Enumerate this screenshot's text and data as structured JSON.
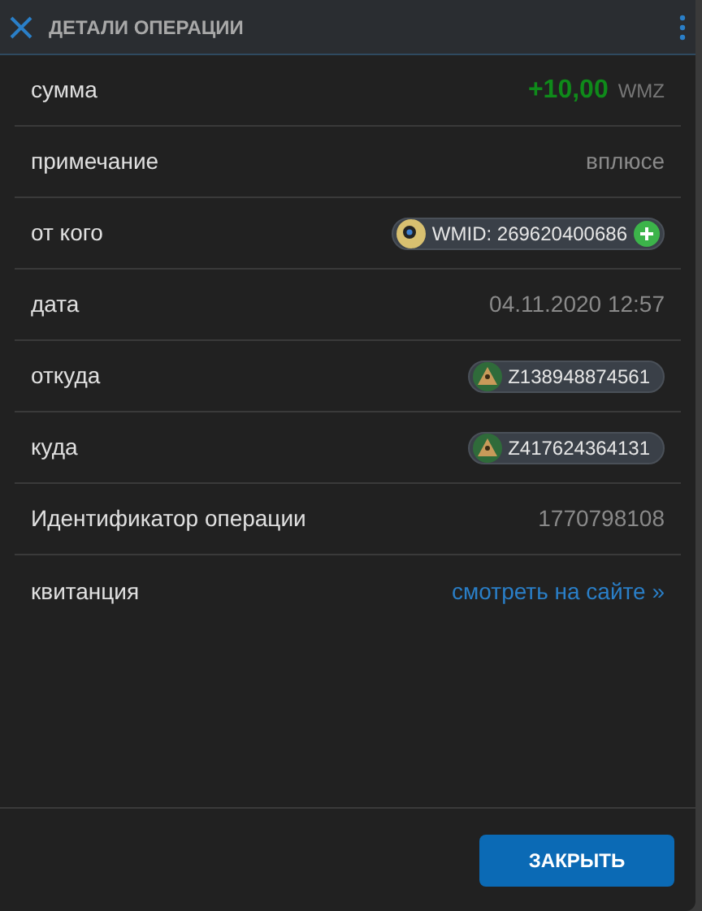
{
  "header": {
    "title": "ДЕТАЛИ ОПЕРАЦИИ"
  },
  "rows": [
    {
      "label": "сумма",
      "kind": "amount",
      "value": "+10,00",
      "unit": "WMZ"
    },
    {
      "label": "примечание",
      "kind": "text",
      "value": "вплюсе"
    },
    {
      "label": "от кого",
      "kind": "wmid",
      "value": "WMID: 269620400686"
    },
    {
      "label": "дата",
      "kind": "text",
      "value": "04.11.2020 12:57"
    },
    {
      "label": "откуда",
      "kind": "purse",
      "value": "Z138948874561"
    },
    {
      "label": "куда",
      "kind": "purse",
      "value": "Z417624364131"
    },
    {
      "label": "Идентификатор операции",
      "kind": "text",
      "value": "1770798108"
    },
    {
      "label": "квитанция",
      "kind": "link",
      "value": "смотреть на сайте »"
    }
  ],
  "footer": {
    "button": "ЗАКРЫТЬ"
  }
}
